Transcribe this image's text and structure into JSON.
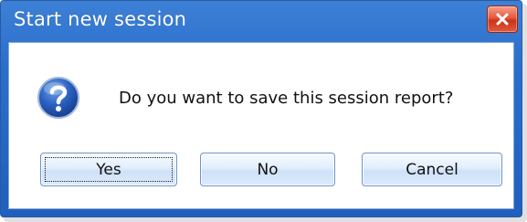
{
  "dialog": {
    "title": "Start new session",
    "message": "Do you want to save this session report?",
    "icon": "question-icon",
    "buttons": {
      "yes_label": "Yes",
      "no_label": "No",
      "cancel_label": "Cancel"
    },
    "focused_button": "Yes",
    "colors": {
      "titlebar": "#2b6fcc",
      "close_button": "#e04a2c",
      "button_border": "#6f93c8",
      "icon_blue": "#1f4fa8"
    }
  }
}
